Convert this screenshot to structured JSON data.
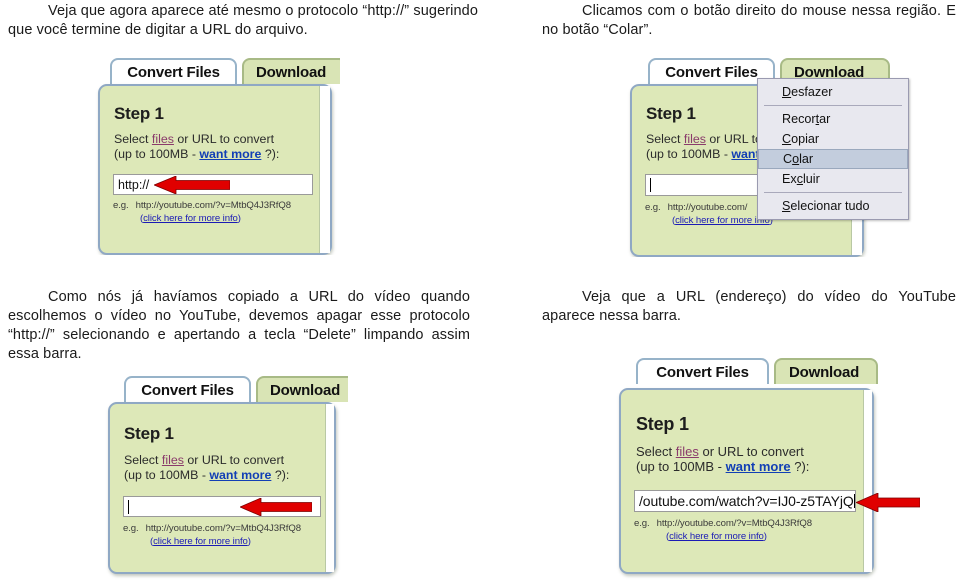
{
  "paragraphs": {
    "top_left": "Veja que agora aparece até mesmo o protocolo “http://” sugerindo que você termine de digitar a URL do arquivo.",
    "top_right": "Clicamos com o botão direito do mouse nessa região. E no botão “Colar”.",
    "mid_left": "Como nós já havíamos copiado a URL do vídeo quando escolhemos o vídeo no YouTube, devemos apagar esse protocolo “http://” selecionando e apertando a tecla “Delete” limpando assim essa barra.",
    "mid_right": "Veja que a URL (endereço) do vídeo do YouTube aparece nessa barra."
  },
  "app": {
    "tabs": {
      "convert_files": "Convert Files",
      "download": "Download"
    },
    "step_title": "Step 1",
    "desc_line1_a": "Select ",
    "desc_line1_files": "files",
    "desc_line1_b": " or URL to convert",
    "desc_line1_b_clipped": " or URL to",
    "desc_line2_a": "(up to 100MB - ",
    "desc_line2_more": "want more",
    "desc_line2_b": " ?):",
    "desc_line2_more_clipped": "want",
    "example_label": "e.g.",
    "example_url": "http://youtube.com/?v=MtbQ4J3RfQ8",
    "example_url_clipped": "http://youtube.com/",
    "more_info_open": "(",
    "more_info_link": "click here for more info",
    "more_info_close": ")"
  },
  "inputs": {
    "protocol_value": "http://",
    "empty_value": "",
    "youtube_value": "/outube.com/watch?v=IJ0-z5TAYjQ"
  },
  "context_menu": {
    "items": [
      {
        "pre": "",
        "accel": "D",
        "post": "esfazer",
        "selected": false
      },
      {
        "pre": "Recor",
        "accel": "t",
        "post": "ar",
        "selected": false
      },
      {
        "pre": "",
        "accel": "C",
        "post": "opiar",
        "selected": false
      },
      {
        "pre": "C",
        "accel": "o",
        "post": "lar",
        "selected": true
      },
      {
        "pre": "Ex",
        "accel": "c",
        "post": "luir",
        "selected": false
      },
      {
        "pre": "",
        "accel": "S",
        "post": "elecionar tudo",
        "selected": false
      }
    ]
  },
  "colors": {
    "panel_bg": "#dde8b8",
    "panel_border": "#8fa8c4",
    "tab_inactive_bg": "#d9e4b5",
    "arrow_red": "#e00000",
    "link_blue": "#123fb5",
    "link_magenta": "#8a3b6b",
    "menu_bg": "#e8e8ef",
    "menu_selected": "#c3cddd"
  },
  "icons": {
    "arrow": "arrow-left-icon",
    "caret": "text-caret-icon"
  }
}
